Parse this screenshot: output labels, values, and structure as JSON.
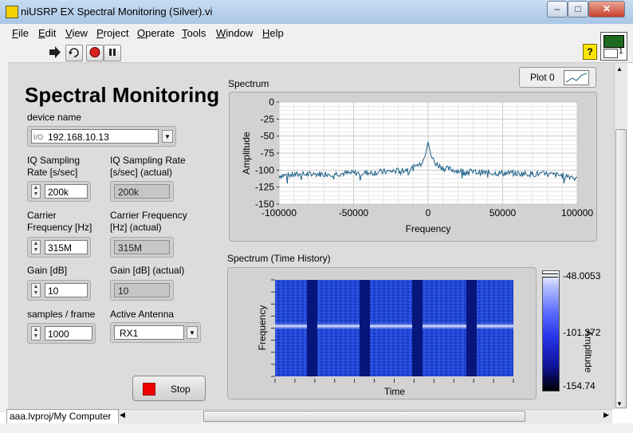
{
  "window": {
    "title": "niUSRP EX Spectral Monitoring (Silver).vi",
    "minimize": "–",
    "maximize": "□",
    "close": "✕"
  },
  "menu": [
    "File",
    "Edit",
    "View",
    "Project",
    "Operate",
    "Tools",
    "Window",
    "Help"
  ],
  "toolbar": {
    "run_icon": "run-arrow-icon",
    "continuous_icon": "run-continuously-icon",
    "abort_icon": "abort-icon",
    "pause_icon": "pause-icon",
    "help_label": "?",
    "connector_number": "1"
  },
  "panel": {
    "heading": "Spectral Monitoring",
    "device": {
      "label": "device name",
      "io_tag": "I/O",
      "value": "192.168.10.13"
    },
    "iq_rate": {
      "label": "IQ Sampling Rate [s/sec]",
      "value": "200k"
    },
    "iq_rate_actual": {
      "label": "IQ Sampling Rate [s/sec] (actual)",
      "value": "200k"
    },
    "carrier": {
      "label": "Carrier Frequency [Hz]",
      "value": "315M"
    },
    "carrier_actual": {
      "label": "Carrier Frequency [Hz] (actual)",
      "value": "315M"
    },
    "gain": {
      "label": "Gain [dB]",
      "value": "10"
    },
    "gain_actual": {
      "label": "Gain [dB] (actual)",
      "value": "10"
    },
    "samples": {
      "label": "samples / frame",
      "value": "1000"
    },
    "antenna": {
      "label": "Active Antenna",
      "value": "RX1"
    },
    "stop": {
      "label": "Stop"
    }
  },
  "spectrum_title": "Spectrum",
  "plot_legend": "Plot 0",
  "history_title": "Spectrum (Time History)",
  "status_path": "aaa.lvproj/My Computer",
  "colors": {
    "trace": "#1b5f86",
    "panel": "#dcdcdc",
    "stop_led": "#ee0000"
  },
  "chart_data": [
    {
      "type": "line",
      "title": "Spectrum",
      "xlabel": "Frequency",
      "ylabel": "Amplitude",
      "xlim": [
        -100000,
        100000
      ],
      "ylim": [
        -150,
        0
      ],
      "xticks": [
        "-100000",
        "-50000",
        "0",
        "50000",
        "100000"
      ],
      "yticks": [
        "0",
        "-25",
        "-50",
        "-75",
        "-100",
        "-125",
        "-150"
      ],
      "grid": true,
      "series": [
        {
          "x": [
            -100000,
            -80000,
            -60000,
            -40000,
            -20000,
            -10000,
            -5000,
            -2000,
            0,
            2000,
            5000,
            10000,
            20000,
            40000,
            60000,
            80000,
            100000
          ],
          "values": [
            -108,
            -106,
            -105,
            -104,
            -101,
            -97,
            -90,
            -80,
            -58,
            -80,
            -90,
            -97,
            -101,
            -104,
            -105,
            -106,
            -110
          ]
        }
      ]
    },
    {
      "type": "heatmap",
      "title": "Spectrum (Time History)",
      "xlabel": "Time",
      "ylabel": "Frequency",
      "colorbar_label": "Amplitude",
      "colorbar_ticks": [
        "-48.0053",
        "-101.372",
        "-154.74"
      ],
      "zlim": [
        -154.74,
        -48.0053
      ]
    }
  ]
}
